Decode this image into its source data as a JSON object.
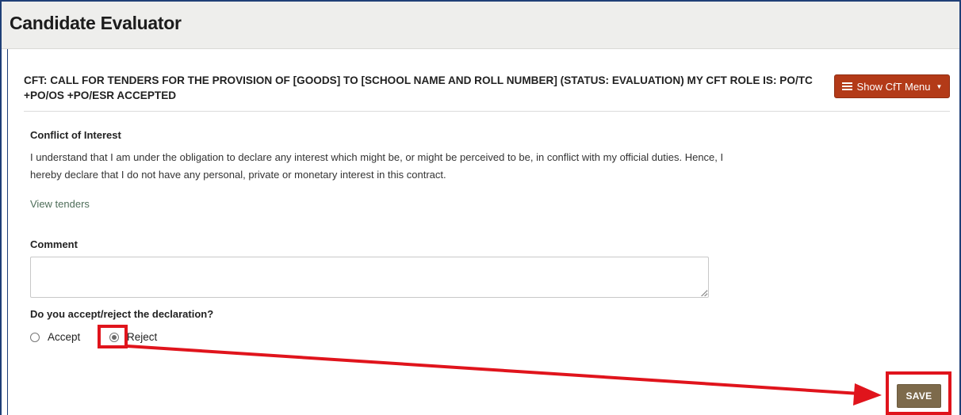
{
  "app": {
    "title": "Candidate Evaluator"
  },
  "cft": {
    "heading": "CFT: CALL FOR TENDERS FOR THE PROVISION OF [GOODS] TO [SCHOOL NAME AND ROLL NUMBER] (STATUS: EVALUATION) MY CFT ROLE IS: PO/TC +PO/OS +PO/ESR ACCEPTED",
    "menu_button_label": "Show CfT Menu",
    "menu_icon": "list-icon",
    "caret_icon": "caret-down-icon"
  },
  "conflict": {
    "title": "Conflict of Interest",
    "text": "I understand that I am under the obligation to declare any interest which might be, or might be perceived to be, in conflict with my official duties. Hence, I hereby declare that I do not have any personal, private or monetary interest in this contract.",
    "view_tenders_link": "View tenders"
  },
  "comment": {
    "label": "Comment",
    "value": ""
  },
  "declaration": {
    "question": "Do you accept/reject the declaration?",
    "options": [
      {
        "label": "Accept",
        "selected": false
      },
      {
        "label": "Reject",
        "selected": true
      }
    ]
  },
  "actions": {
    "save_label": "SAVE"
  },
  "annotation": {
    "highlight_color": "#e0141c"
  },
  "colors": {
    "accent_menu": "#b33a18",
    "save_button": "#7d6a4b",
    "link": "#4f6e5a",
    "titlebar_bg": "#eeeeec"
  }
}
